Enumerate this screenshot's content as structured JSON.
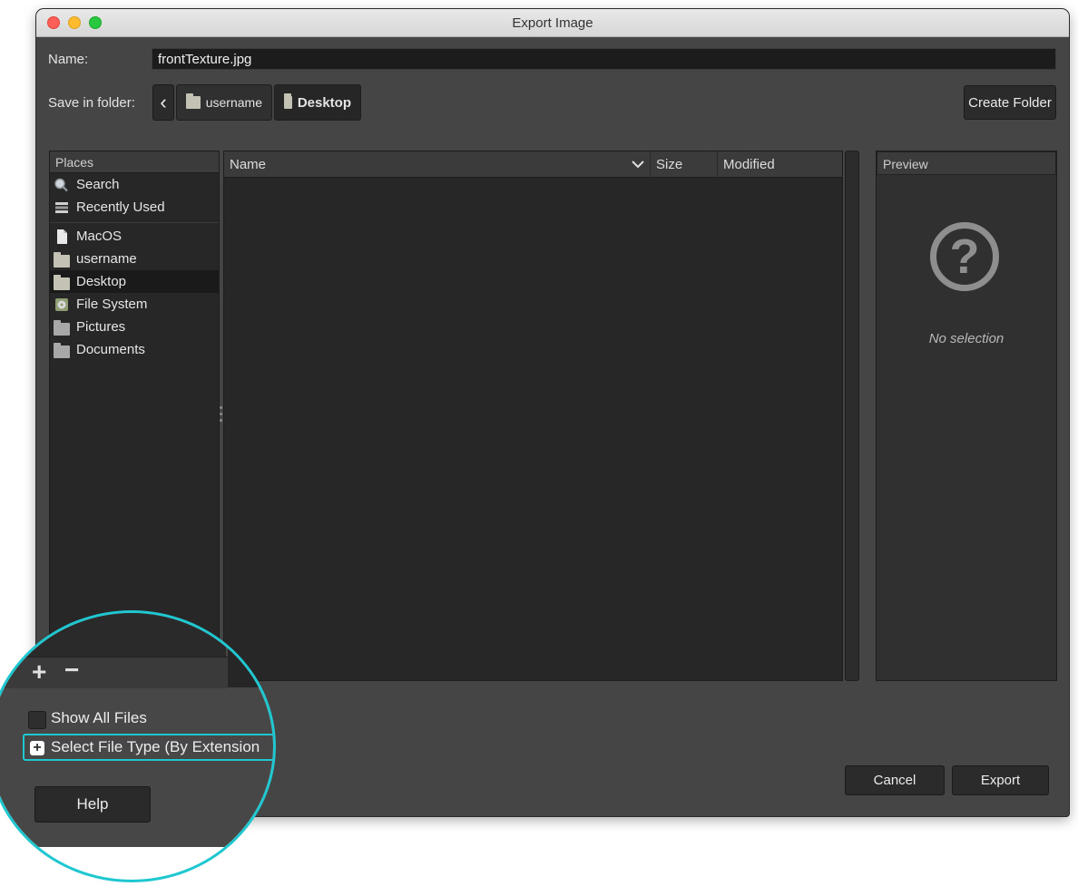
{
  "window": {
    "title": "Export Image"
  },
  "name_row": {
    "label": "Name:",
    "value": "frontTexture.jpg"
  },
  "folder_row": {
    "label": "Save in folder:",
    "back_glyph": "‹",
    "crumbs": [
      {
        "label": "username",
        "icon": "folder-icon"
      },
      {
        "label": "Desktop",
        "icon": "folder-icon"
      }
    ],
    "create_folder": "Create Folder"
  },
  "places": {
    "header": "Places",
    "items": [
      {
        "label": "Search",
        "icon": "search-icon"
      },
      {
        "label": "Recently Used",
        "icon": "recent-icon"
      },
      {
        "label": "MacOS",
        "icon": "document-icon"
      },
      {
        "label": "username",
        "icon": "folder-icon"
      },
      {
        "label": "Desktop",
        "icon": "folder-icon",
        "selected": true
      },
      {
        "label": "File System",
        "icon": "disk-icon"
      },
      {
        "label": "Pictures",
        "icon": "folder-icon"
      },
      {
        "label": "Documents",
        "icon": "folder-icon"
      }
    ],
    "add_glyph": "+",
    "remove_glyph": "−"
  },
  "files": {
    "columns": {
      "name": "Name",
      "size": "Size",
      "modified": "Modified"
    },
    "rows": []
  },
  "preview": {
    "header": "Preview",
    "empty_text": "No selection",
    "icon": "question-icon"
  },
  "options": {
    "show_all_files": "Show All Files",
    "select_file_type": "Select File Type (By Extension"
  },
  "buttons": {
    "help": "Help",
    "cancel": "Cancel",
    "export": "Export"
  },
  "colors": {
    "highlight": "#1fc7d0",
    "window_bg": "#454545"
  }
}
